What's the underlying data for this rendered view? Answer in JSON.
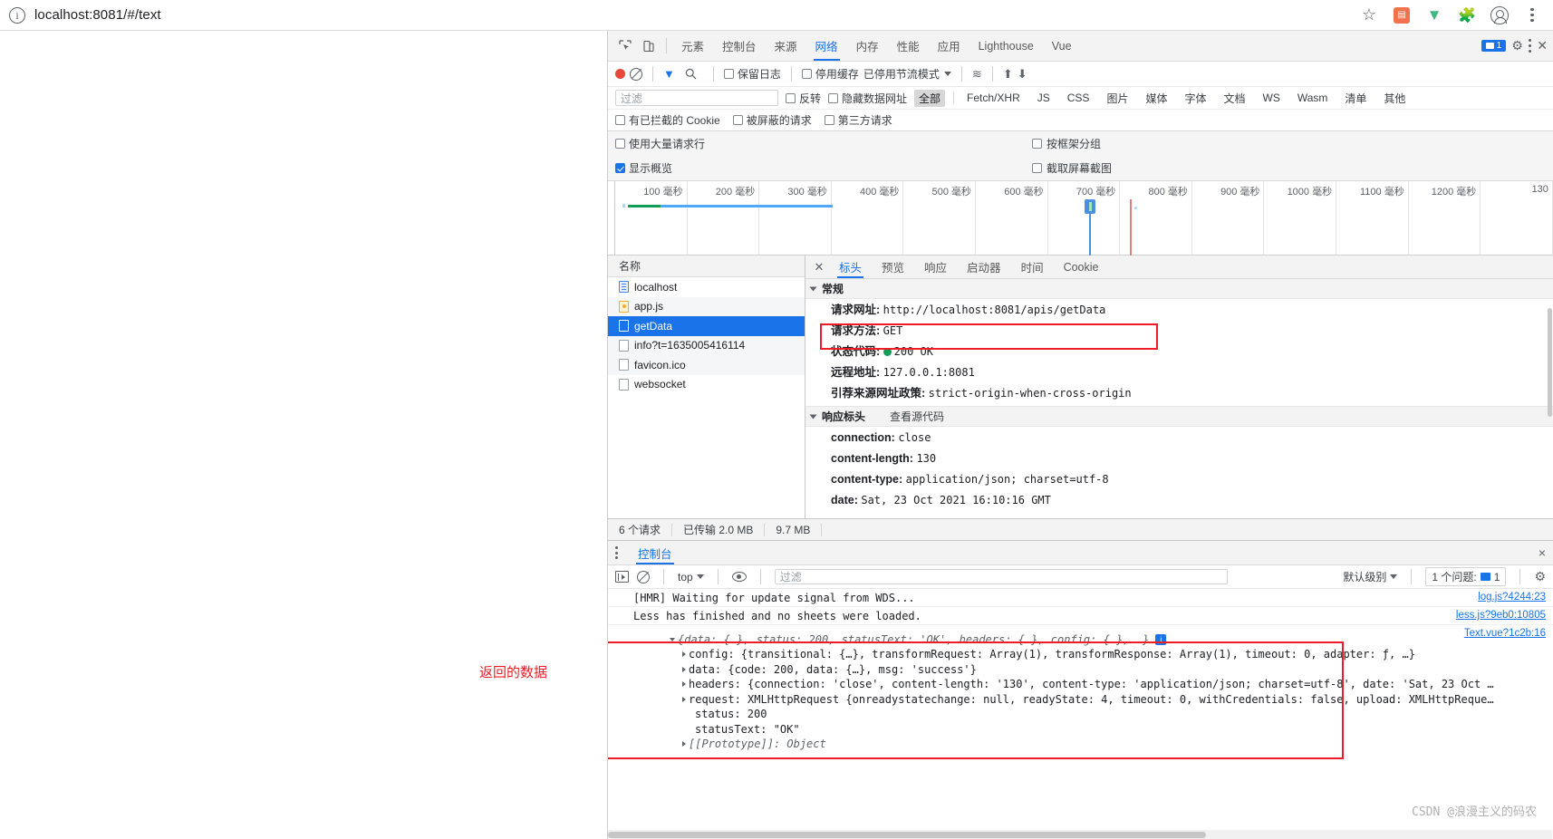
{
  "browser": {
    "url": "localhost:8081/#/text",
    "icons": [
      "info-circle-icon",
      "star-icon",
      "extension-orange-icon",
      "vue-devtools-icon",
      "extensions-puzzle-icon",
      "profile-avatar-icon",
      "chrome-menu-icon"
    ]
  },
  "devtools": {
    "tabs": [
      {
        "label": "元素",
        "active": false
      },
      {
        "label": "控制台",
        "active": false
      },
      {
        "label": "来源",
        "active": false
      },
      {
        "label": "网络",
        "active": true
      },
      {
        "label": "内存",
        "active": false
      },
      {
        "label": "性能",
        "active": false
      },
      {
        "label": "应用",
        "active": false
      },
      {
        "label": "Lighthouse",
        "active": false
      },
      {
        "label": "Vue",
        "active": false
      }
    ],
    "issue_count": "1",
    "network_toolbar": {
      "preserve_log": "保留日志",
      "disable_cache": "停用缓存",
      "throttling": "已停用节流模式"
    },
    "filter": {
      "placeholder": "过滤",
      "invert": "反转",
      "hide_data_urls": "隐藏数据网址",
      "types": [
        "全部",
        "Fetch/XHR",
        "JS",
        "CSS",
        "图片",
        "媒体",
        "字体",
        "文档",
        "WS",
        "Wasm",
        "清单",
        "其他"
      ],
      "selected_type": "全部",
      "blocked_cookies": "有已拦截的 Cookie",
      "blocked_requests": "被屏蔽的请求",
      "third_party": "第三方请求"
    },
    "settings": {
      "big_rows": "使用大量请求行",
      "group_by_frame": "按框架分组",
      "show_overview": "显示概览",
      "capture_screenshots": "截取屏幕截图"
    },
    "overview_ticks": [
      "100 毫秒",
      "200 毫秒",
      "300 毫秒",
      "400 毫秒",
      "500 毫秒",
      "600 毫秒",
      "700 毫秒",
      "800 毫秒",
      "900 毫秒",
      "1000 毫秒",
      "1100 毫秒",
      "1200 毫秒",
      "130"
    ]
  },
  "requests": {
    "column_name": "名称",
    "rows": [
      {
        "name": "localhost",
        "icon": "document-icon",
        "selected": false
      },
      {
        "name": "app.js",
        "icon": "script-icon",
        "selected": false
      },
      {
        "name": "getData",
        "icon": "xhr-icon",
        "selected": true
      },
      {
        "name": "info?t=1635005416114",
        "icon": "xhr-icon",
        "selected": false
      },
      {
        "name": "favicon.ico",
        "icon": "xhr-icon",
        "selected": false
      },
      {
        "name": "websocket",
        "icon": "xhr-icon",
        "selected": false
      }
    ],
    "status": {
      "count": "6 个请求",
      "transferred": "已传输 2.0 MB",
      "resources": "9.7 MB"
    }
  },
  "details": {
    "tabs": [
      {
        "label": "标头",
        "active": true
      },
      {
        "label": "预览",
        "active": false
      },
      {
        "label": "响应",
        "active": false
      },
      {
        "label": "启动器",
        "active": false
      },
      {
        "label": "时间",
        "active": false
      },
      {
        "label": "Cookie",
        "active": false
      }
    ],
    "general": {
      "title": "常规",
      "items": [
        {
          "key": "请求网址:",
          "value": "http://localhost:8081/apis/getData",
          "highlight": true
        },
        {
          "key": "请求方法:",
          "value": "GET",
          "highlight": false
        },
        {
          "key": "状态代码:",
          "value": "200 OK",
          "status_dot": "#0f9d58",
          "highlight": false
        },
        {
          "key": "远程地址:",
          "value": "127.0.0.1:8081",
          "highlight": false
        },
        {
          "key": "引荐来源网址政策:",
          "value": "strict-origin-when-cross-origin",
          "highlight": false
        }
      ]
    },
    "response_headers": {
      "title": "响应标头",
      "view_source": "查看源代码",
      "items": [
        {
          "key": "connection:",
          "value": "close"
        },
        {
          "key": "content-length:",
          "value": "130"
        },
        {
          "key": "content-type:",
          "value": "application/json; charset=utf-8"
        },
        {
          "key": "date:",
          "value": "Sat, 23 Oct 2021 16:10:16 GMT"
        }
      ]
    }
  },
  "drawer": {
    "tab": "控制台",
    "close_label": "×",
    "toolbar": {
      "context": "top",
      "filter_placeholder": "过滤",
      "level": "默认级别",
      "issues": "1 个问题:",
      "issues_count": "1"
    },
    "logs": [
      {
        "text": "[HMR] Waiting for update signal from WDS...",
        "source": "log.js?4244:23"
      },
      {
        "text": "Less has finished and no sheets were loaded.",
        "source": "less.js?9eb0:10805"
      },
      {
        "text": "",
        "source": "Text.vue?1c2b:16"
      }
    ],
    "object_tree": {
      "root": "{data: {…}, status: 200, statusText: 'OK', headers: {…}, config: {…}, …}",
      "rows": [
        "config: {transitional: {…}, transformRequest: Array(1), transformResponse: Array(1), timeout: 0, adapter: ƒ, …}",
        "data: {code: 200, data: {…}, msg: 'success'}",
        "headers: {connection: 'close', content-length: '130', content-type: 'application/json; charset=utf-8', date: 'Sat, 23 Oct …",
        "request: XMLHttpRequest {onreadystatechange: null, readyState: 4, timeout: 0, withCredentials: false, upload: XMLHttpReque…",
        "status: 200",
        "statusText: \"OK\"",
        "[[Prototype]]: Object"
      ]
    }
  },
  "annotations": {
    "returned_data_label": "返回的数据",
    "watermark": "CSDN @浪漫主义的码农"
  }
}
